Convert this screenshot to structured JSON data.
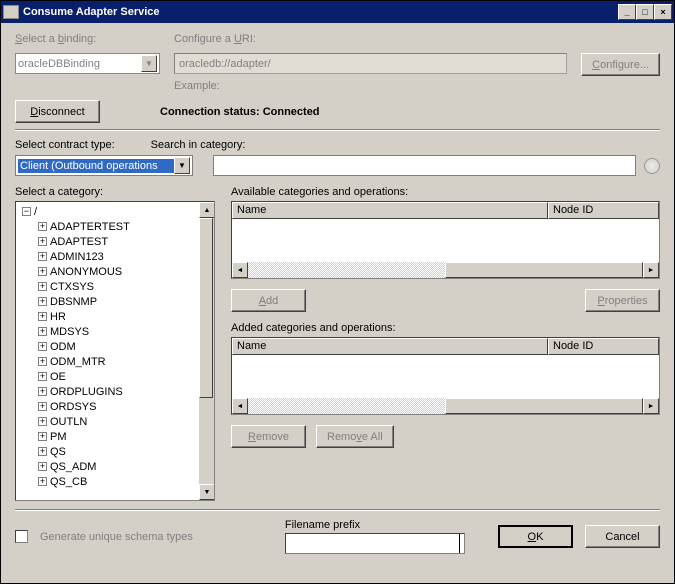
{
  "window": {
    "title": "Consume Adapter Service"
  },
  "binding": {
    "label": "Select a binding:",
    "value": "oracleDBBinding"
  },
  "uri": {
    "label": "Configure a URI:",
    "value": "oracledb://adapter/",
    "example_label": "Example:"
  },
  "buttons": {
    "configure": "Configure...",
    "disconnect": "Disconnect",
    "add": "Add",
    "properties": "Properties",
    "remove": "Remove",
    "removeall": "Remove All",
    "ok": "OK",
    "cancel": "Cancel"
  },
  "status": {
    "label": "Connection status:",
    "value": "Connected"
  },
  "contract": {
    "label": "Select contract type:",
    "value": "Client (Outbound operations"
  },
  "search": {
    "label": "Search in category:",
    "value": ""
  },
  "category": {
    "label": "Select a category:",
    "root": "/",
    "items": [
      "ADAPTERTEST",
      "ADAPTEST",
      "ADMIN123",
      "ANONYMOUS",
      "CTXSYS",
      "DBSNMP",
      "HR",
      "MDSYS",
      "ODM",
      "ODM_MTR",
      "OE",
      "ORDPLUGINS",
      "ORDSYS",
      "OUTLN",
      "PM",
      "QS",
      "QS_ADM",
      "QS_CB"
    ]
  },
  "available": {
    "label": "Available categories and operations:",
    "cols": {
      "name": "Name",
      "nodeid": "Node ID"
    }
  },
  "added": {
    "label": "Added categories and operations:",
    "cols": {
      "name": "Name",
      "nodeid": "Node ID"
    }
  },
  "footer": {
    "checkbox_label": "Generate unique schema types",
    "fileprefix_label": "Filename prefix"
  }
}
